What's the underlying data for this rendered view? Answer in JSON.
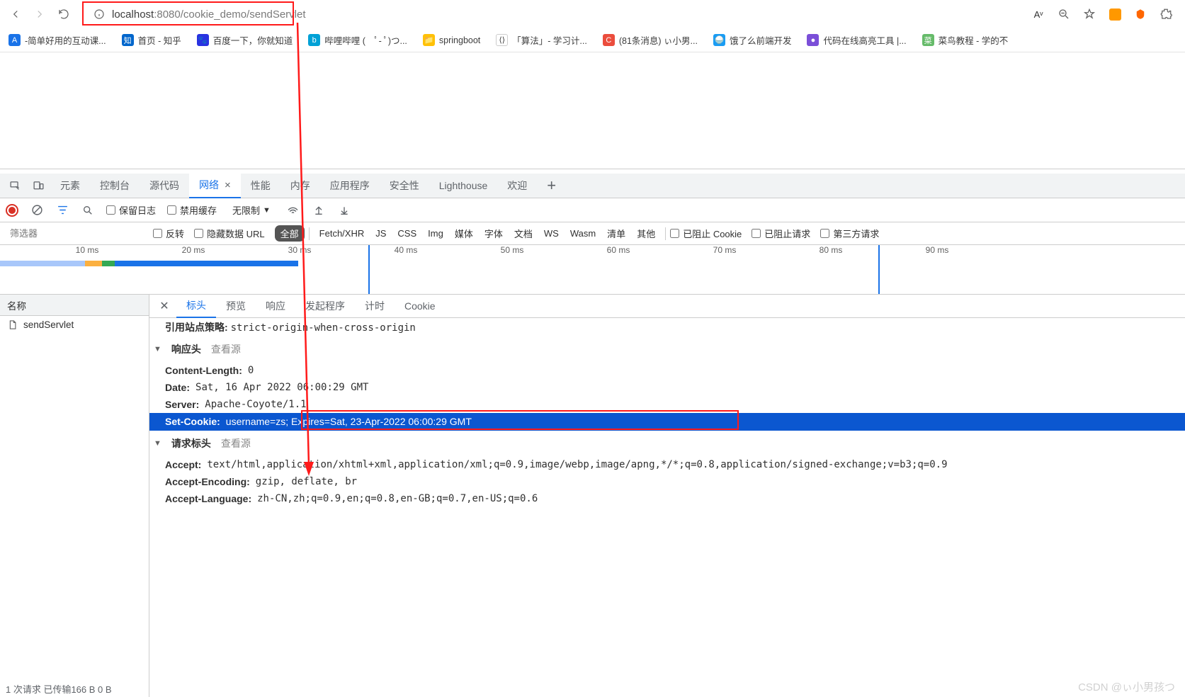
{
  "browser": {
    "url_host": "localhost",
    "url_path": ":8080/cookie_demo/sendServlet",
    "voice_label": "Aᵛ"
  },
  "bookmarks": [
    {
      "icon_bg": "#1a73e8",
      "icon_txt": "A",
      "label": "-简单好用的互动课..."
    },
    {
      "icon_bg": "#0066cc",
      "icon_txt": "知",
      "label": "首页 - 知乎"
    },
    {
      "icon_bg": "#2932e1",
      "icon_txt": "🐾",
      "label": "百度一下，你就知道"
    },
    {
      "icon_bg": "#00a1d6",
      "icon_txt": "b",
      "label": "哔哩哔哩 (　ﾟ- ﾟ)つ..."
    },
    {
      "icon_bg": "#ffc107",
      "icon_txt": "📁",
      "label": "springboot"
    },
    {
      "icon_bg": "#fff",
      "icon_txt": "⟨⟩",
      "label": "「算法」- 学习计..."
    },
    {
      "icon_bg": "#eb4d3d",
      "icon_txt": "C",
      "label": "(81条消息) ぃ小男..."
    },
    {
      "icon_bg": "#1a9cf3",
      "icon_txt": "🍚",
      "label": "饿了么前端开发"
    },
    {
      "icon_bg": "#7b4fd8",
      "icon_txt": "●",
      "label": "代码在线高亮工具 |..."
    },
    {
      "icon_bg": "#66bb6a",
      "icon_txt": "菜",
      "label": "菜鸟教程 - 学的不"
    }
  ],
  "devtools": {
    "tabs": [
      "元素",
      "控制台",
      "源代码",
      "网络",
      "性能",
      "内存",
      "应用程序",
      "安全性",
      "Lighthouse",
      "欢迎"
    ],
    "active_tab": "网络",
    "filter": {
      "preserve_log": "保留日志",
      "disable_cache": "禁用缓存",
      "throttling": "无限制",
      "filter_placeholder": "筛选器",
      "invert": "反转",
      "hide_data_urls": "隐藏数据 URL",
      "types": [
        "全部",
        "Fetch/XHR",
        "JS",
        "CSS",
        "Img",
        "媒体",
        "字体",
        "文档",
        "WS",
        "Wasm",
        "清单",
        "其他"
      ],
      "blocked_cookies": "已阻止 Cookie",
      "blocked_requests": "已阻止请求",
      "third_party": "第三方请求"
    },
    "timeline_ticks": [
      "10 ms",
      "20 ms",
      "30 ms",
      "40 ms",
      "50 ms",
      "60 ms",
      "70 ms",
      "80 ms",
      "90 ms"
    ],
    "request_list": {
      "header": "名称",
      "items": [
        "sendServlet"
      ]
    },
    "detail": {
      "tabs": [
        "标头",
        "预览",
        "响应",
        "发起程序",
        "计时",
        "Cookie"
      ],
      "active_tab": "标头",
      "referrer_policy_label": "引用站点策略:",
      "referrer_policy_value": "strict-origin-when-cross-origin",
      "response_headers_label": "响应头",
      "view_source": "查看源",
      "request_headers_label": "请求标头",
      "response_headers": [
        {
          "k": "Content-Length:",
          "v": "0"
        },
        {
          "k": "Date:",
          "v": "Sat, 16 Apr 2022 06:00:29 GMT"
        },
        {
          "k": "Server:",
          "v": "Apache-Coyote/1.1"
        }
      ],
      "set_cookie_k": "Set-Cookie:",
      "set_cookie_v": "username=zs; Expires=Sat, 23-Apr-2022 06:00:29 GMT",
      "request_headers": [
        {
          "k": "Accept:",
          "v": "text/html,application/xhtml+xml,application/xml;q=0.9,image/webp,image/apng,*/*;q=0.8,application/signed-exchange;v=b3;q=0.9"
        },
        {
          "k": "Accept-Encoding:",
          "v": "gzip, deflate, br"
        },
        {
          "k": "Accept-Language:",
          "v": "zh-CN,zh;q=0.9,en;q=0.8,en-GB;q=0.7,en-US;q=0.6"
        }
      ]
    },
    "status_bar": "1 次请求  已传输166 B  0 B",
    "watermark": "CSDN @ぃ小男孩つ"
  }
}
